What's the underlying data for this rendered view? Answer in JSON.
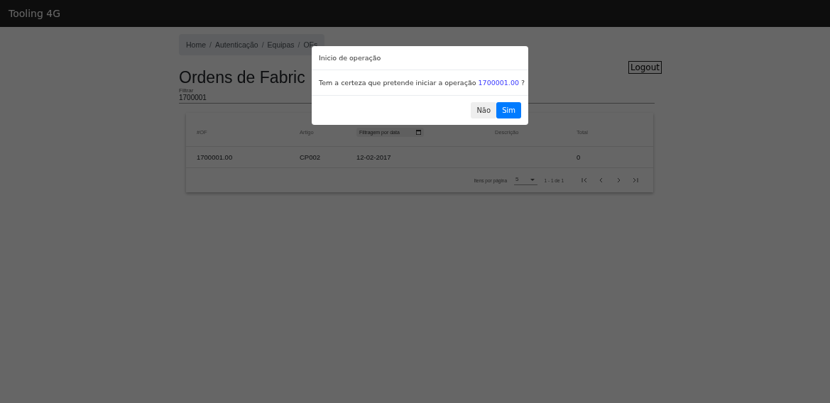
{
  "app_bar": {
    "title": "Tooling 4G"
  },
  "breadcrumb": {
    "separator": "/",
    "items": [
      "Home",
      "Autenticação",
      "Equipas",
      "OFs"
    ]
  },
  "heading": "Ordens de Fabric",
  "logout_button": "Logout",
  "filter": {
    "label": "Filtrar",
    "value": "1700001"
  },
  "table": {
    "columns": [
      {
        "kind": "text",
        "label": "#OF"
      },
      {
        "kind": "text",
        "label": "Artigo"
      },
      {
        "kind": "date",
        "placeholder": "Filtragem por data"
      },
      {
        "kind": "text",
        "label": "Descrição"
      },
      {
        "kind": "text",
        "label": "Total"
      }
    ],
    "rows": [
      [
        "1700001.00",
        "CP002",
        "12-02-2017",
        "",
        "0"
      ]
    ]
  },
  "paginator": {
    "label": "Itens por página",
    "page_size": "5",
    "range": "1 - 1 de 1"
  },
  "dialog": {
    "title": "Inicio de operação",
    "message": "Tem a certeza que pretende iniciar a operação",
    "operation": "1700001.00",
    "suffix": "?",
    "buttons": [
      {
        "label": "Não",
        "kind": "secondary"
      },
      {
        "label": "Sim",
        "kind": "primary"
      }
    ]
  }
}
